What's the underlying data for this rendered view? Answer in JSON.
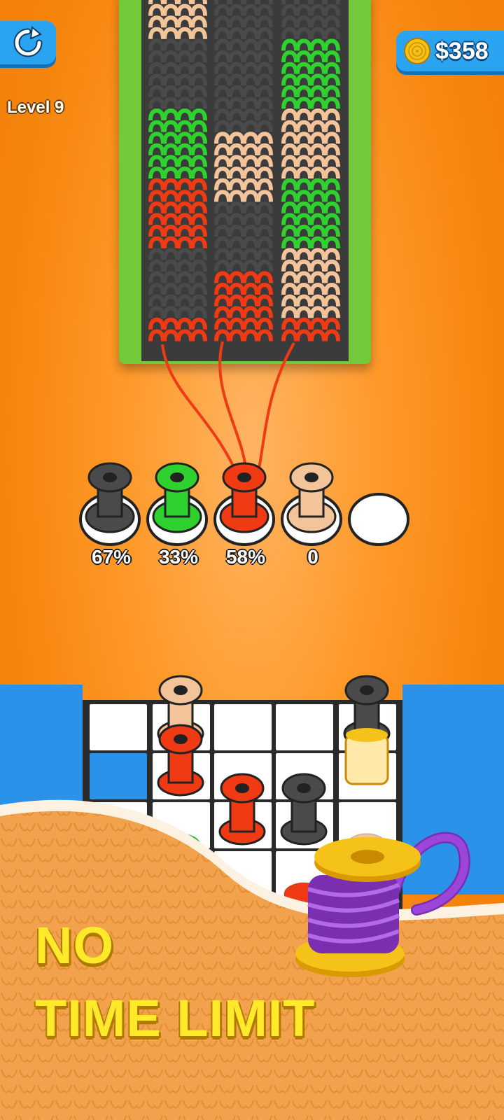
{
  "hud": {
    "coins": "$358",
    "level": "Level 9"
  },
  "spools": [
    {
      "color": "#4a4a4a",
      "percent": "67%"
    },
    {
      "color": "#2fd12f",
      "percent": "33%"
    },
    {
      "color": "#f03a14",
      "percent": "58%"
    },
    {
      "color": "#f3c39a",
      "percent": "0"
    },
    {
      "color": "",
      "percent": ""
    }
  ],
  "banner": {
    "line1": "NO",
    "line2": "TIME LIMIT"
  },
  "colors": {
    "gray": "#4a4a4a",
    "green": "#2fd12f",
    "red": "#f03a14",
    "peach": "#f3c39a",
    "blue": "#2aa4f0",
    "yellow": "#ffe92a",
    "purple": "#9b46d8"
  }
}
